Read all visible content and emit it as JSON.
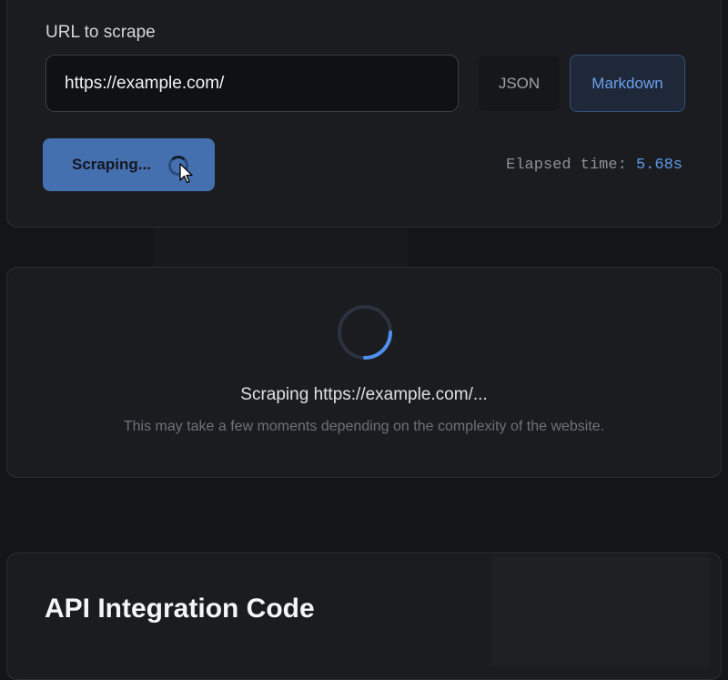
{
  "form": {
    "url_label": "URL to scrape",
    "url_value": "https://example.com/",
    "formats": [
      {
        "label": "JSON",
        "selected": false
      },
      {
        "label": "Markdown",
        "selected": true
      }
    ],
    "scrape_button_label": "Scraping...",
    "elapsed_label": "Elapsed time:",
    "elapsed_value": "5.68s"
  },
  "status": {
    "title": "Scraping https://example.com/...",
    "subtitle": "This may take a few moments depending on the complexity of the website."
  },
  "api": {
    "title": "API Integration Code"
  },
  "icons": {
    "button_spinner": "loading-spinner-icon",
    "cursor": "mouse-pointer-icon",
    "main_spinner": "loading-spinner-icon"
  },
  "colors": {
    "accent": "#4f8ff0",
    "button_bg": "#4570b0",
    "background": "#141518",
    "card": "#1b1c20"
  }
}
